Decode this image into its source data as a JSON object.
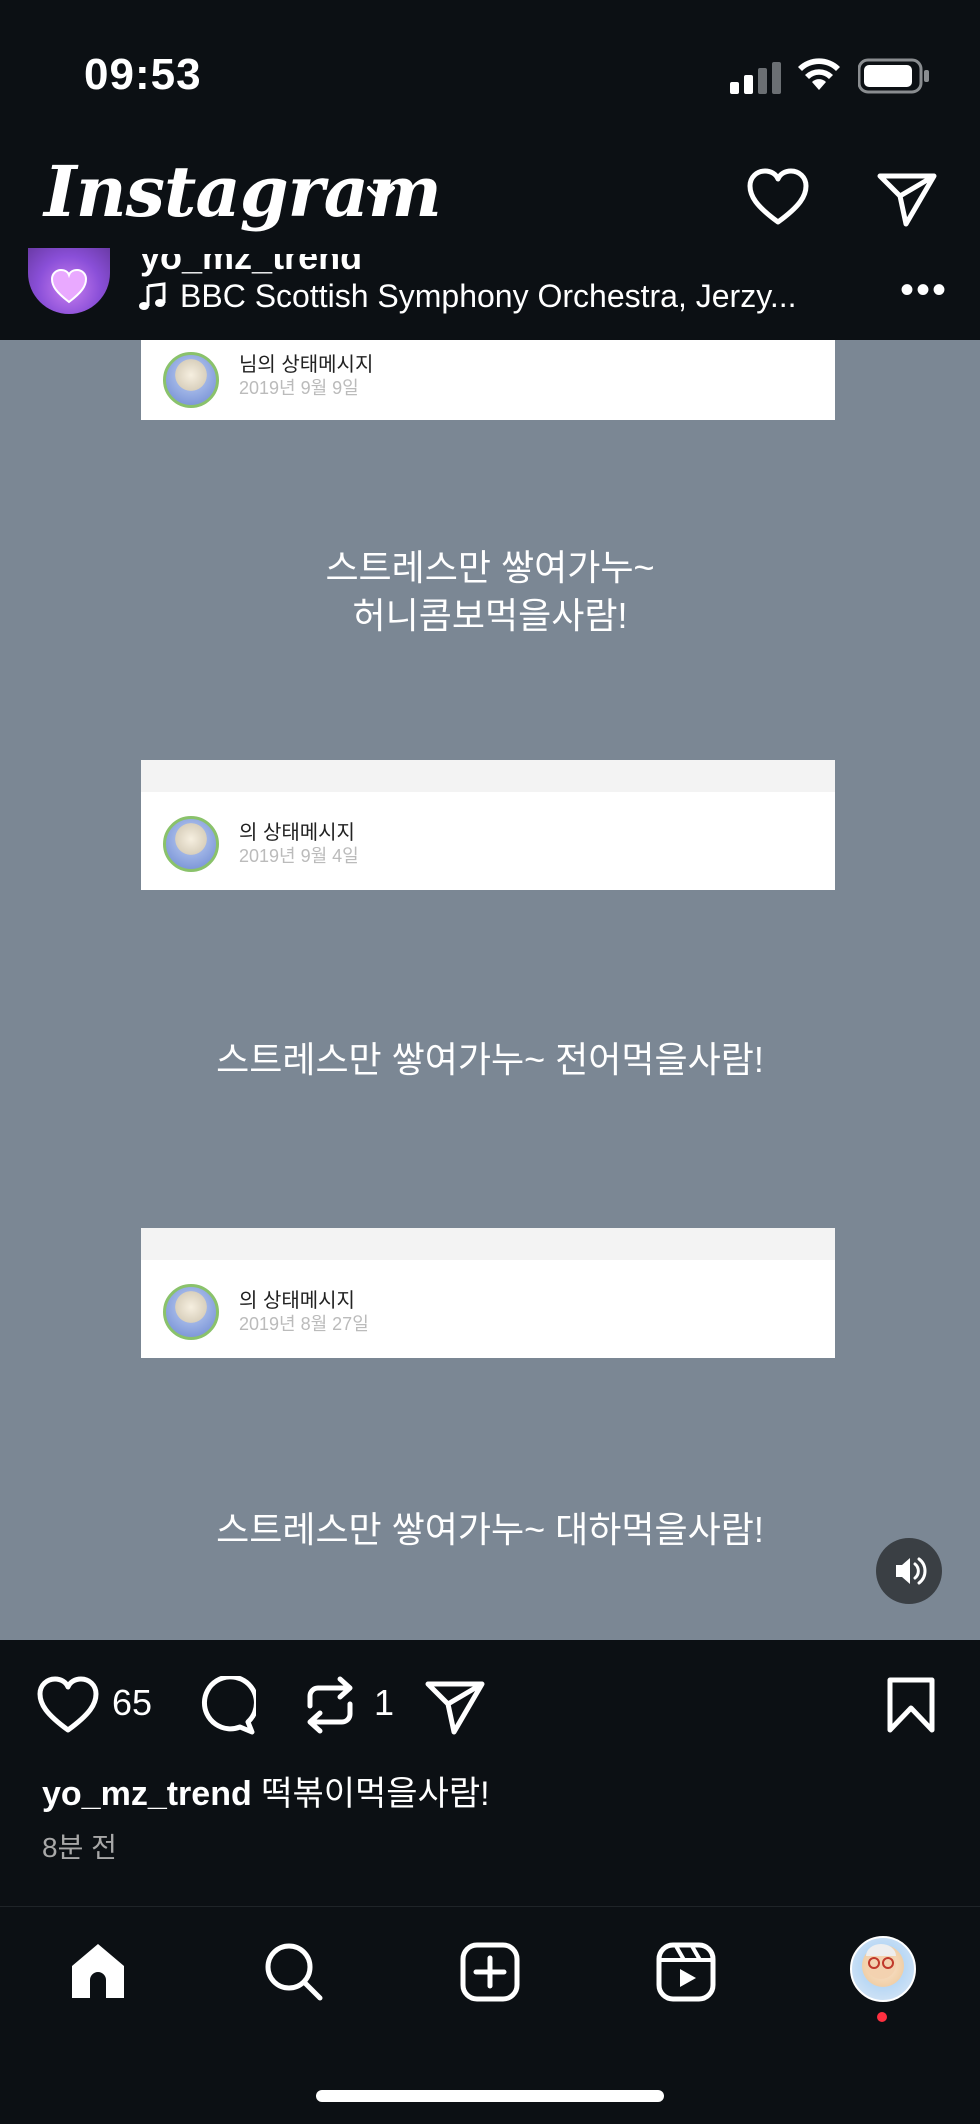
{
  "status_bar": {
    "time": "09:53",
    "icons": [
      "signal-icon",
      "wifi-icon",
      "battery-icon"
    ]
  },
  "app_bar": {
    "title": "Instagram",
    "icons": [
      "chevron-down-icon",
      "heart-icon",
      "send-icon"
    ]
  },
  "post": {
    "username": "yo_mz_trend",
    "music": "BBC Scottish Symphony Orchestra, Jerzy...",
    "more_label": "•••",
    "cards": [
      {
        "name": "님의 상태메시지",
        "date": "2019년 9월 9일"
      },
      {
        "name": "의 상태메시지",
        "date": "2019년 9월 4일"
      },
      {
        "name": "의 상태메시지",
        "date": "2019년 8월 27일"
      }
    ],
    "overlay_lines": [
      "스트레스만 쌓여가누~",
      "허니콤보먹을사람!",
      "스트레스만 쌓여가누~ 전어먹을사람!",
      "스트레스만 쌓여가누~ 대하먹을사람!"
    ],
    "likes": "65",
    "reposts": "1",
    "caption_user": "yo_mz_trend",
    "caption_text": "떡볶이먹을사람!",
    "time_ago": "8분 전"
  },
  "bottom_nav": {
    "items": [
      "home-icon",
      "search-icon",
      "create-icon",
      "reels-icon",
      "profile-avatar"
    ]
  },
  "colors": {
    "background": "#0c1014",
    "media_bg": "#7b8794",
    "notification_dot": "#ff3040"
  }
}
